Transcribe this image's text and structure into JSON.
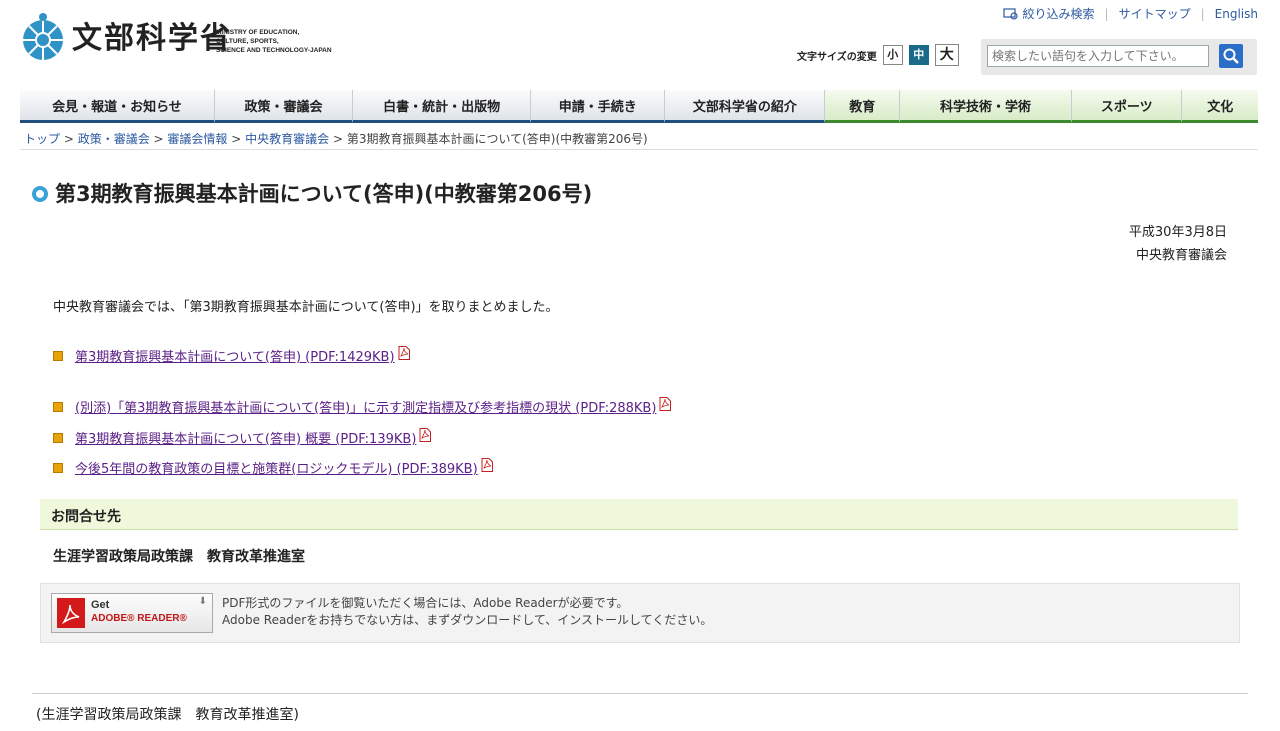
{
  "header": {
    "logo_jp": "文部科学省",
    "logo_en": [
      "MINISTRY OF EDUCATION,",
      "CULTURE, SPORTS,",
      "SCIENCE AND TECHNOLOGY-JAPAN"
    ],
    "top_links": [
      "絞り込み検索",
      "サイトマップ",
      "English"
    ],
    "font_size_label": "文字サイズの変更",
    "font_sizes": [
      "小",
      "中",
      "大"
    ],
    "search_placeholder": "検索したい語句を入力して下さい。"
  },
  "nav": {
    "items": [
      {
        "label": "会見・報道・お知らせ",
        "width": 195
      },
      {
        "label": "政策・審議会",
        "width": 138
      },
      {
        "label": "白書・統計・出版物",
        "width": 178
      },
      {
        "label": "申請・手続き",
        "width": 134
      },
      {
        "label": "文部科学省の紹介",
        "width": 160
      },
      {
        "label": "教育",
        "width": 74
      },
      {
        "label": "科学技術・学術",
        "width": 172
      },
      {
        "label": "スポーツ",
        "width": 110
      },
      {
        "label": "文化",
        "width": 77
      }
    ]
  },
  "breadcrumb": [
    "トップ",
    "政策・審議会",
    "審議会情報",
    "中央教育審議会",
    "第3期教育振興基本計画について(答申)(中教審第206号)"
  ],
  "main": {
    "title": "第3期教育振興基本計画について(答申)(中教審第206号)",
    "date": "平成30年3月8日",
    "issuer": "中央教育審議会",
    "intro": "中央教育審議会では、「第3期教育振興基本計画について(答申)」を取りまとめました。",
    "documents": [
      {
        "label": "第3期教育振興基本計画について(答申) (PDF:1429KB)"
      },
      {
        "label": "(別添)「第3期教育振興基本計画について(答申)」に示す測定指標及び参考指標の現状 (PDF:288KB)"
      },
      {
        "label": "第3期教育振興基本計画について(答申) 概要 (PDF:139KB)"
      },
      {
        "label": "今後5年間の教育政策の目標と施策群(ロジックモデル) (PDF:389KB)"
      }
    ],
    "contact_title": "お問合せ先",
    "contact_body": "生涯学習政策局政策課　教育改革推進室"
  },
  "adobe": {
    "get": "Get",
    "reader": "ADOBE® READER®",
    "text1": "PDF形式のファイルを御覧いただく場合には、Adobe Readerが必要です。",
    "text2": "Adobe Readerをお持ちでない方は、まずダウンロードして、インストールしてください。"
  },
  "footer": {
    "text": "(生涯学習政策局政策課　教育改革推進室)"
  }
}
